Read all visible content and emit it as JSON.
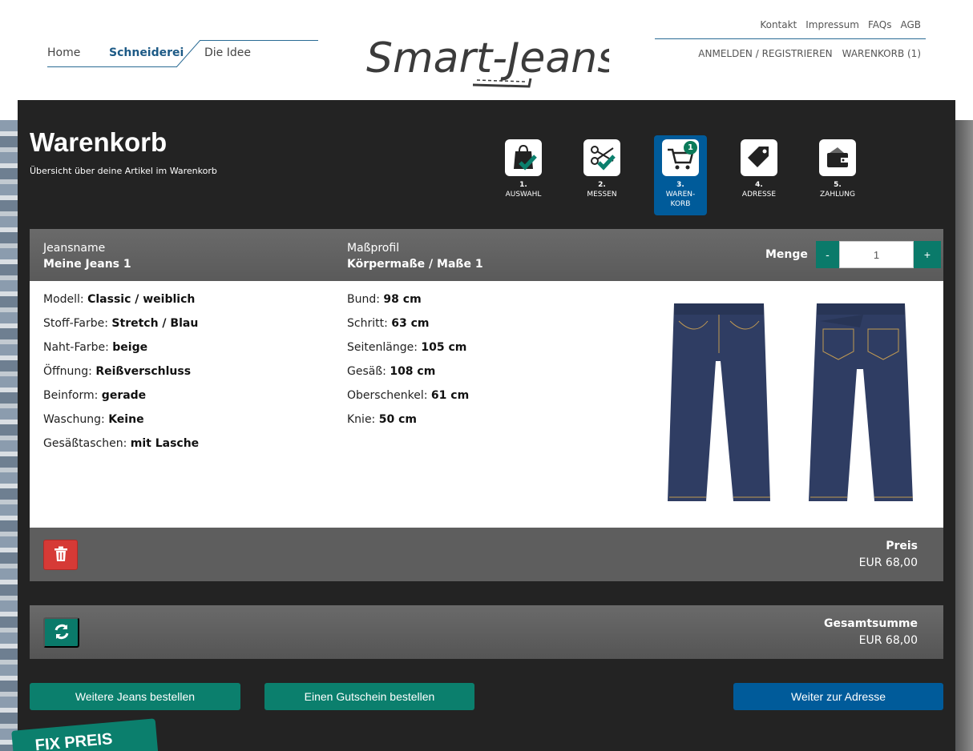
{
  "nav": {
    "home": "Home",
    "schneiderei": "Schneiderei",
    "idee": "Die Idee"
  },
  "top_links": [
    "Kontakt",
    "Impressum",
    "FAQs",
    "AGB"
  ],
  "account": {
    "login": "ANMELDEN / REGISTRIEREN",
    "cart": "WARENKORB (1)"
  },
  "logo": {
    "text": "Smart-Jeans"
  },
  "page": {
    "title": "Warenkorb",
    "subtitle": "Übersicht über deine Artikel im Warenkorb"
  },
  "steps": [
    {
      "num": "1.",
      "label": "AUSWAHL",
      "icon": "bag-icon"
    },
    {
      "num": "2.",
      "label": "MESSEN",
      "icon": "scissors-icon"
    },
    {
      "num": "3.",
      "label": "WAREN-",
      "label2": "KORB",
      "icon": "cart-icon",
      "badge": "1"
    },
    {
      "num": "4.",
      "label": "ADRESSE",
      "icon": "tag-icon"
    },
    {
      "num": "5.",
      "label": "ZAHLUNG",
      "icon": "wallet-icon"
    }
  ],
  "item": {
    "name_label": "Jeansname",
    "name": "Meine Jeans 1",
    "profile_label": "Maßprofil",
    "profile": "Körpermaße / Maße 1",
    "qty_label": "Menge",
    "qty": "1",
    "minus": "-",
    "plus": "+",
    "specs_left": [
      {
        "k": "Modell:",
        "v": "Classic / weiblich"
      },
      {
        "k": "Stoff-Farbe:",
        "v": "Stretch / Blau"
      },
      {
        "k": "Naht-Farbe:",
        "v": "beige"
      },
      {
        "k": "Öffnung:",
        "v": "Reißverschluss"
      },
      {
        "k": "Beinform:",
        "v": "gerade"
      },
      {
        "k": "Waschung:",
        "v": "Keine"
      },
      {
        "k": "Gesäßtaschen:",
        "v": "mit Lasche"
      }
    ],
    "specs_right": [
      {
        "k": "Bund:",
        "v": "98 cm"
      },
      {
        "k": "Schritt:",
        "v": "63 cm"
      },
      {
        "k": "Seitenlänge:",
        "v": "105 cm"
      },
      {
        "k": "Gesäß:",
        "v": "108 cm"
      },
      {
        "k": "Oberschenkel:",
        "v": "61 cm"
      },
      {
        "k": "Knie:",
        "v": "50 cm"
      }
    ],
    "price_label": "Preis",
    "price": "EUR 68,00"
  },
  "total": {
    "label": "Gesamtsumme",
    "value": "EUR 68,00"
  },
  "buttons": {
    "more_jeans": "Weitere Jeans bestellen",
    "voucher": "Einen Gutschein bestellen",
    "next": "Weiter zur Adresse"
  },
  "ribbon": "FIX PREIS",
  "colors": {
    "accent_blue": "#005b9a",
    "accent_teal": "#0b7f6d",
    "danger": "#d63a36",
    "panel_bg": "#232323"
  }
}
